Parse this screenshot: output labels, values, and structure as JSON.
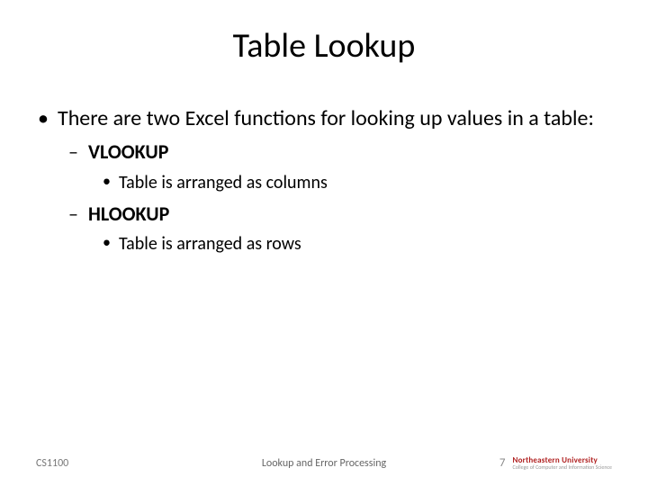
{
  "title": "Table Lookup",
  "bullets": {
    "main": "There are two Excel functions for looking up values in a table:",
    "items": [
      {
        "name": "VLOOKUP",
        "desc": "Table is arranged as columns"
      },
      {
        "name": "HLOOKUP",
        "desc": "Table is arranged as rows"
      }
    ]
  },
  "footer": {
    "left": "CS1100",
    "center": "Lookup and Error Processing",
    "page": "7",
    "logo_top": "Northeastern University",
    "logo_bot": "College of Computer and Information Science"
  }
}
